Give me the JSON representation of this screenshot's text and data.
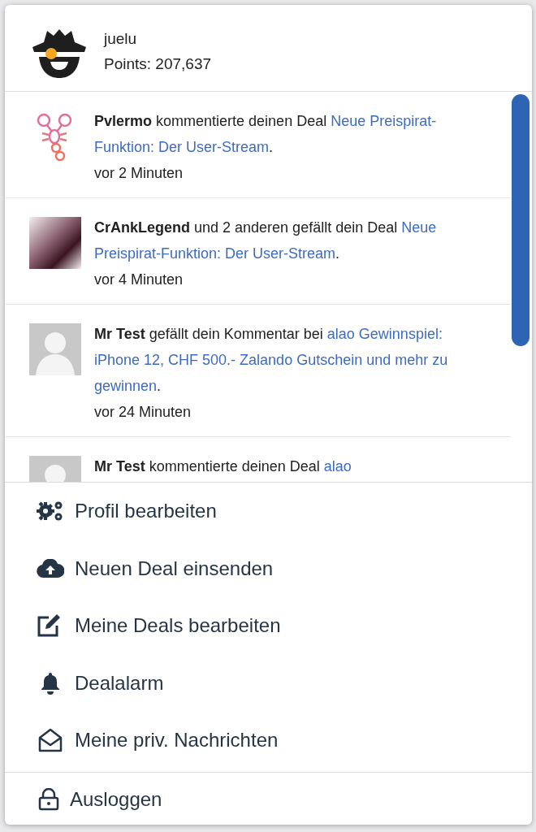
{
  "user": {
    "name": "juelu",
    "points": "Points: 207,637"
  },
  "notifications": [
    {
      "kind": "scorpion",
      "actor": "Pvlermo",
      "action": "kommentierte deinen Deal",
      "link": "Neue Preispirat-Funktion: Der User-Stream",
      "after": ".",
      "time": "vor 2 Minuten"
    },
    {
      "kind": "photo",
      "actor": "CrAnkLegend",
      "action": "und 2 anderen gefällt dein Deal",
      "link": "Neue Preispirat-Funktion: Der User-Stream",
      "after": ".",
      "time": "vor 4 Minuten"
    },
    {
      "kind": "default",
      "actor": "Mr Test",
      "action": "gefällt dein Kommentar bei",
      "link": "alao Gewinnspiel: iPhone 12, CHF 500.- Zalando Gutschein und mehr zu gewinnen",
      "after": ".",
      "time": "vor 24 Minuten"
    },
    {
      "kind": "default",
      "actor": "Mr Test",
      "action": "kommentierte deinen Deal",
      "link": "alao"
    }
  ],
  "menu": [
    {
      "kind": "gears",
      "label": "Profil bearbeiten"
    },
    {
      "kind": "cloud",
      "label": "Neuen Deal einsenden"
    },
    {
      "kind": "edit",
      "label": "Meine Deals bearbeiten"
    },
    {
      "kind": "bell",
      "label": "Dealalarm"
    },
    {
      "kind": "envelope",
      "label": "Meine priv. Nachrichten"
    }
  ],
  "logout": {
    "kind": "lock",
    "label": "Ausloggen"
  }
}
